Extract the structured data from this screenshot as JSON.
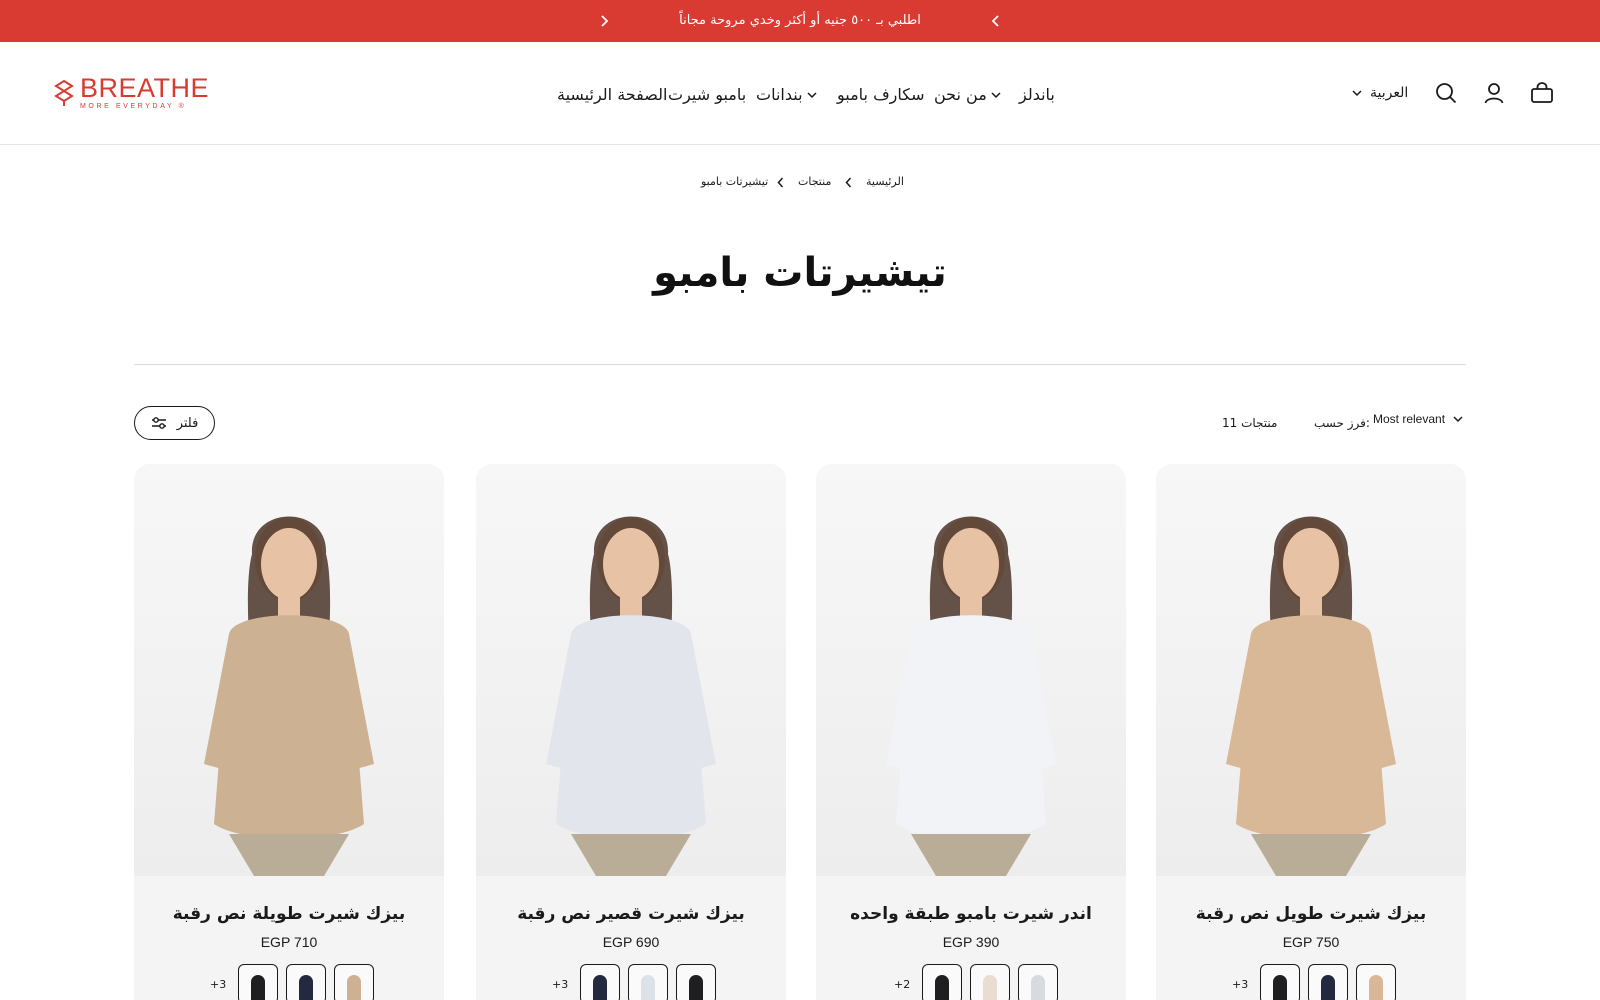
{
  "announcement": {
    "message": "اطلبي بـ ٥٠٠ جنيه أو أكثر وخدي مروحة مجاناً"
  },
  "header": {
    "logo_word": "BREATHE",
    "logo_tagline": "MORE EVERYDAY ®",
    "nav": {
      "bundles": "باندلز",
      "about": "من نحن",
      "scarves": "سكارف بامبو",
      "bandanas": "بندانات",
      "bamboo_shirt": "بامبو شيرت",
      "home": "الصفحة الرئيسية"
    },
    "language": "العربية"
  },
  "breadcrumb": {
    "home": "الرئيسية",
    "products": "منتجات",
    "current": "تيشيرتات بامبو"
  },
  "page": {
    "title": "تيشيرتات بامبو"
  },
  "toolbar": {
    "filter_label": "فلتر",
    "count": "11 منتجات",
    "sort_label": "فرز حسب:",
    "sort_value": "Most relevant"
  },
  "products": [
    {
      "name": "بيزك شيرت طويل نص رقبة",
      "price": "EGP 750",
      "more": "+3",
      "top_color": "#d8b896",
      "swatches": [
        "#1f1f22",
        "#232a3f",
        "#d8b896"
      ]
    },
    {
      "name": "اندر شيرت بامبو طبقة واحده",
      "price": "EGP 390",
      "more": "+2",
      "top_color": "#f1f3f6",
      "swatches": [
        "#1f1f22",
        "#e9ddd2",
        "#d7dbe0"
      ]
    },
    {
      "name": "بيزك شيرت قصير نص رقبة",
      "price": "EGP 690",
      "more": "+3",
      "top_color": "#e2e6ec",
      "swatches": [
        "#232a3f",
        "#dde2e8",
        "#1f1f22"
      ]
    },
    {
      "name": "بيزك شيرت طويلة نص رقبة",
      "price": "EGP 710",
      "more": "+3",
      "top_color": "#cdb193",
      "swatches": [
        "#1f1f22",
        "#232a3f",
        "#cdb193"
      ]
    }
  ],
  "colors": {
    "brand": "#d93a32",
    "card_bg": "#f4f4f4"
  }
}
